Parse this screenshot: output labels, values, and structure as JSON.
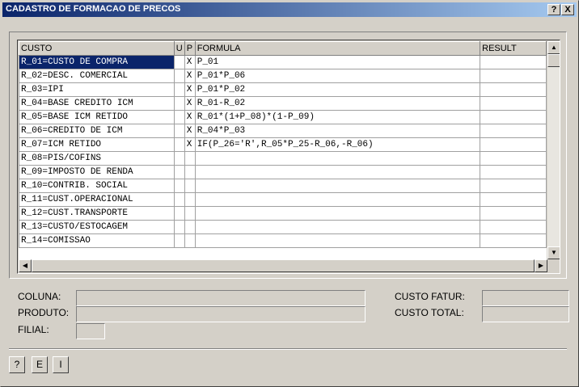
{
  "window": {
    "title": "CADASTRO DE FORMACAO DE PRECOS",
    "help_label": "?",
    "close_label": "X"
  },
  "grid": {
    "columns": [
      "CUSTO",
      "U",
      "P",
      "FORMULA",
      "RESULT"
    ],
    "rows": [
      {
        "custo": "R_01=CUSTO DE COMPRA",
        "u": "",
        "p": "X",
        "formula": "P_01",
        "result": ""
      },
      {
        "custo": "R_02=DESC. COMERCIAL",
        "u": "",
        "p": "X",
        "formula": "P_01*P_06",
        "result": ""
      },
      {
        "custo": "R_03=IPI",
        "u": "",
        "p": "X",
        "formula": "P_01*P_02",
        "result": ""
      },
      {
        "custo": "R_04=BASE CREDITO ICM",
        "u": "",
        "p": "X",
        "formula": "R_01-R_02",
        "result": ""
      },
      {
        "custo": "R_05=BASE ICM RETIDO",
        "u": "",
        "p": "X",
        "formula": "R_01*(1+P_08)*(1-P_09)",
        "result": ""
      },
      {
        "custo": "R_06=CREDITO DE ICM",
        "u": "",
        "p": "X",
        "formula": "R_04*P_03",
        "result": ""
      },
      {
        "custo": "R_07=ICM RETIDO",
        "u": "",
        "p": "X",
        "formula": "IF(P_26='R',R_05*P_25-R_06,-R_06)",
        "result": ""
      },
      {
        "custo": "R_08=PIS/COFINS",
        "u": "",
        "p": "",
        "formula": "",
        "result": ""
      },
      {
        "custo": "R_09=IMPOSTO DE RENDA",
        "u": "",
        "p": "",
        "formula": "",
        "result": ""
      },
      {
        "custo": "R_10=CONTRIB. SOCIAL",
        "u": "",
        "p": "",
        "formula": "",
        "result": ""
      },
      {
        "custo": "R_11=CUST.OPERACIONAL",
        "u": "",
        "p": "",
        "formula": "",
        "result": ""
      },
      {
        "custo": "R_12=CUST.TRANSPORTE",
        "u": "",
        "p": "",
        "formula": "",
        "result": ""
      },
      {
        "custo": "R_13=CUSTO/ESTOCAGEM",
        "u": "",
        "p": "",
        "formula": "",
        "result": ""
      },
      {
        "custo": "R_14=COMISSAO",
        "u": "",
        "p": "",
        "formula": "",
        "result": ""
      }
    ],
    "selected_row": 0
  },
  "fields": {
    "coluna_label": "COLUNA:",
    "produto_label": "PRODUTO:",
    "filial_label": "FILIAL:",
    "custo_fatur_label": "CUSTO FATUR:",
    "custo_total_label": "CUSTO TOTAL:",
    "coluna_value": "",
    "produto_value": "",
    "filial_value": "",
    "custo_fatur_value": "",
    "custo_total_value": ""
  },
  "buttons": {
    "help": "?",
    "e": "E",
    "i": "I"
  }
}
